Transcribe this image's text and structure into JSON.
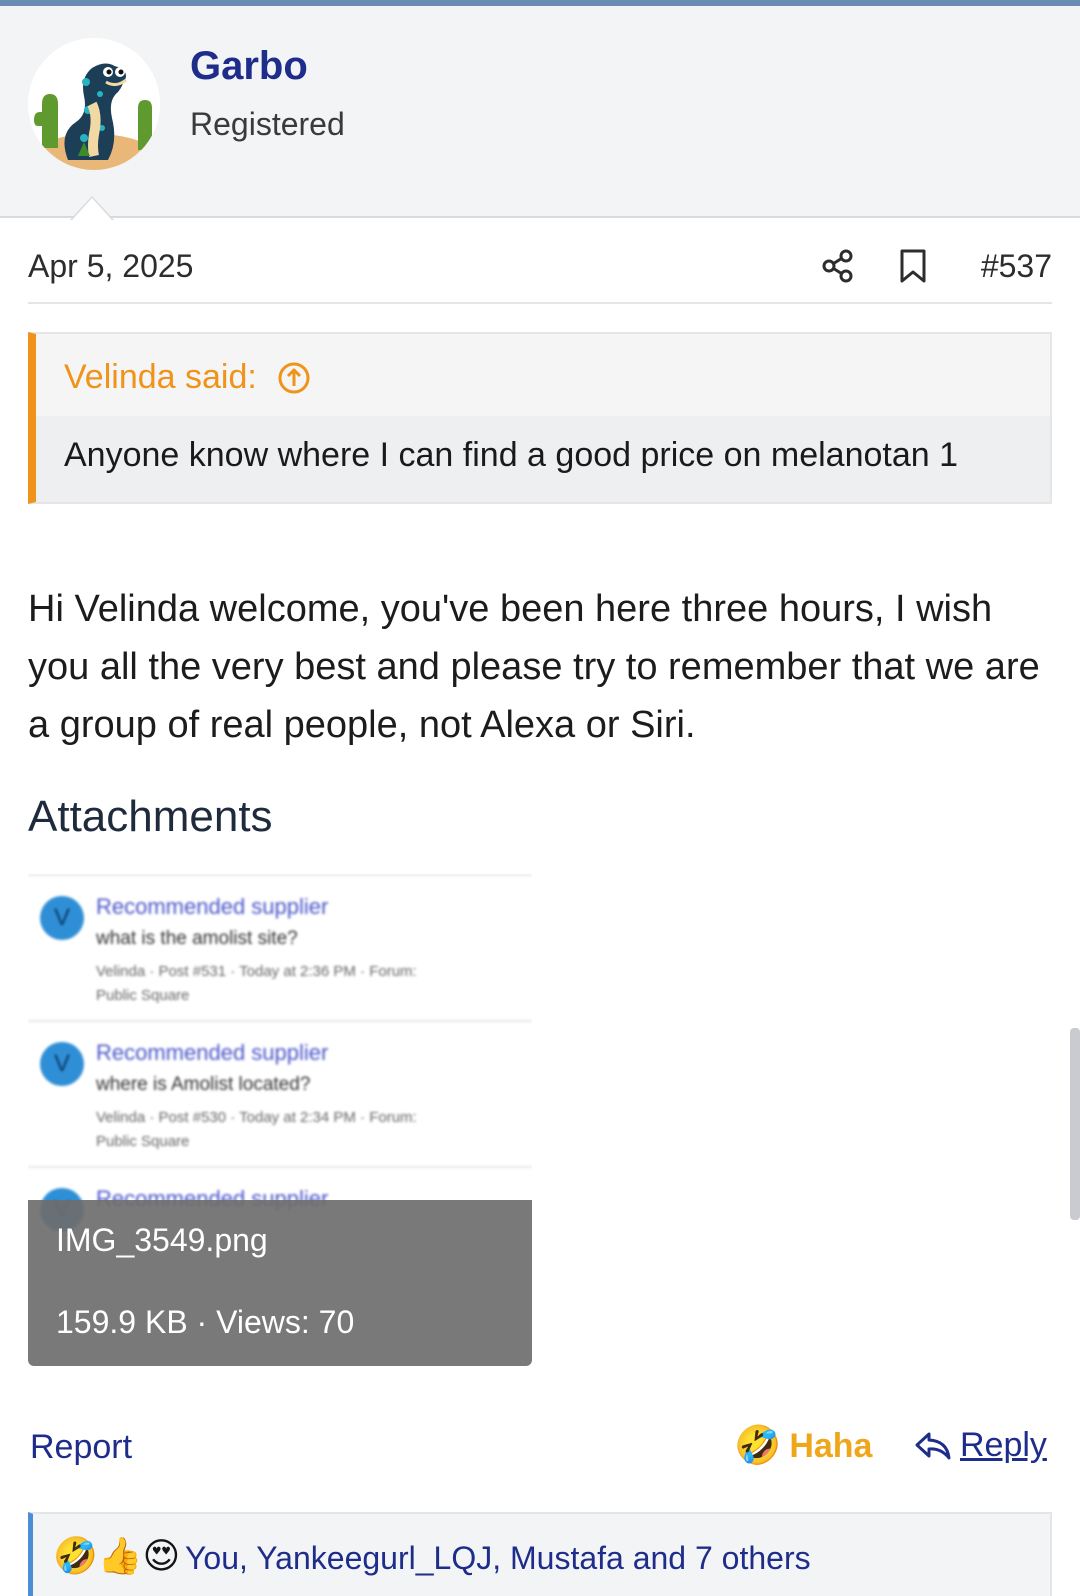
{
  "post": {
    "author": {
      "name": "Garbo",
      "title": "Registered",
      "avatar_icon": "snake-avatar"
    },
    "date": "Apr 5, 2025",
    "number": "#537",
    "quote": {
      "author_said": "Velinda said:",
      "text": "Anyone know where I can find a good price on melanotan 1"
    },
    "message": "Hi Velinda welcome, you've been here three hours, I wish you all the very best and please try to remember that we are a group of real people, not Alexa or Siri.",
    "attachments_heading": "Attachments",
    "attachment": {
      "filename": "IMG_3549.png",
      "meta": "159.9 KB · Views: 70",
      "preview_entries": [
        {
          "avatar_letter": "V",
          "title": "Recommended supplier",
          "line": "what is the amolist site?",
          "meta_line1": "Velinda · Post #531 · Today at 2:36 PM · Forum:",
          "meta_line2": "Public Square"
        },
        {
          "avatar_letter": "V",
          "title": "Recommended supplier",
          "line": "where is Amolist located?",
          "meta_line1": "Velinda · Post #530 · Today at 2:34 PM · Forum:",
          "meta_line2": "Public Square"
        },
        {
          "avatar_letter": "V",
          "title": "Recommended supplier",
          "line": "",
          "meta_line1": "",
          "meta_line2": ""
        }
      ]
    },
    "actions": {
      "report": "Report",
      "haha_emoji": "🤣",
      "haha": "Haha",
      "reply": "Reply"
    },
    "reactions": {
      "emojis": "🤣👍😍",
      "text": "You, Yankeegurl_LQJ, Mustafa and 7 others"
    }
  },
  "colors": {
    "accent_top": "#6a8db5",
    "username": "#1f2d8a",
    "quote_accent": "#f0931a",
    "haha": "#f0a61a",
    "reaction_border": "#4a8fd6"
  }
}
